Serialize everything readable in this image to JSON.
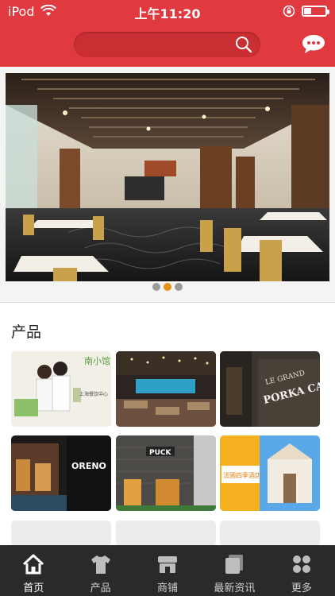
{
  "status_bar": {
    "carrier": "iPod",
    "time": "上午11:20",
    "battery_level": 0.35
  },
  "header": {
    "search_placeholder": "",
    "icons": [
      "search-icon",
      "chat-icon"
    ]
  },
  "banner": {
    "slides": 3,
    "active_slide": 2,
    "active_dot_color": "#e69018"
  },
  "products": {
    "title": "产品",
    "tiles": [
      {
        "sign": "南小馆",
        "caption": "上海餐饮中心"
      },
      {
        "sign": ""
      },
      {
        "sign": "LE GRAND",
        "sign2": "PORKA CAFÉ"
      },
      {
        "sign": "ORENO"
      },
      {
        "sign": "PUCK"
      },
      {
        "sign": "法國四季酒店"
      }
    ]
  },
  "tabbar": {
    "items": [
      {
        "label": "首页",
        "icon": "home-icon",
        "active": true
      },
      {
        "label": "产品",
        "icon": "shirt-icon",
        "active": false
      },
      {
        "label": "商铺",
        "icon": "store-icon",
        "active": false
      },
      {
        "label": "最新资讯",
        "icon": "news-icon",
        "active": false
      },
      {
        "label": "更多",
        "icon": "more-icon",
        "active": false
      }
    ]
  },
  "colors": {
    "brand": "#e0393f",
    "tabbar": "#2a2a2a"
  }
}
